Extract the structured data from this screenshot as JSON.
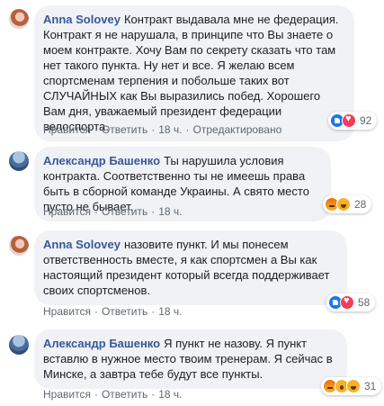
{
  "comments": [
    {
      "author": "Anna Solovey",
      "text": "Контракт выдавала мне не федерация. Контракт я не нарушала, в принципе что Вы знаете о моем контракте. Хочу Вам по секрету сказать что там нет такого пункта. Ну нет и все. Я желаю всем спортсменам терпения и побольше таких вот СЛУЧАЙНЫХ как Вы выразились побед. Хорошего Вам дня, уважаемый президент федерации велоспорта.",
      "like": "Нравится",
      "reply": "Ответить",
      "time": "18 ч.",
      "edited": "Отредактировано",
      "reaction_count": "92",
      "reactions": [
        "like-icon",
        "love-icon"
      ]
    },
    {
      "author": "Александр Башенко",
      "text": "Ты нарушила условия контракта. Соответственно ты не имеешь права быть в сборной команде Украины. А свято место пусто не бывает.",
      "like": "Нравится",
      "reply": "Ответить",
      "time": "18 ч.",
      "reaction_count": "28",
      "reactions": [
        "angry-icon",
        "haha-icon"
      ]
    },
    {
      "author": "Anna Solovey",
      "text": "назовите пункт. И мы понесем ответственность вместе, я как спортсмен а Вы как настоящий президент который всегда поддерживает своих спортсменов.",
      "like": "Нравится",
      "reply": "Ответить",
      "time": "18 ч.",
      "reaction_count": "58",
      "reactions": [
        "like-icon",
        "love-icon"
      ]
    },
    {
      "author": "Александр Башенко",
      "text": "Я пункт не назову. Я пункт вставлю в нужное место твоим тренерам. Я сейчас в Минске, а завтра тебе будут все пункты.",
      "like": "Нравится",
      "reply": "Ответить",
      "time": "18 ч.",
      "reaction_count": "31",
      "reactions": [
        "angry-icon",
        "wow-icon",
        "haha-icon"
      ]
    }
  ],
  "colors": {
    "author": "#385898",
    "bubble": "#f0f2f5",
    "meta": "#606770"
  }
}
